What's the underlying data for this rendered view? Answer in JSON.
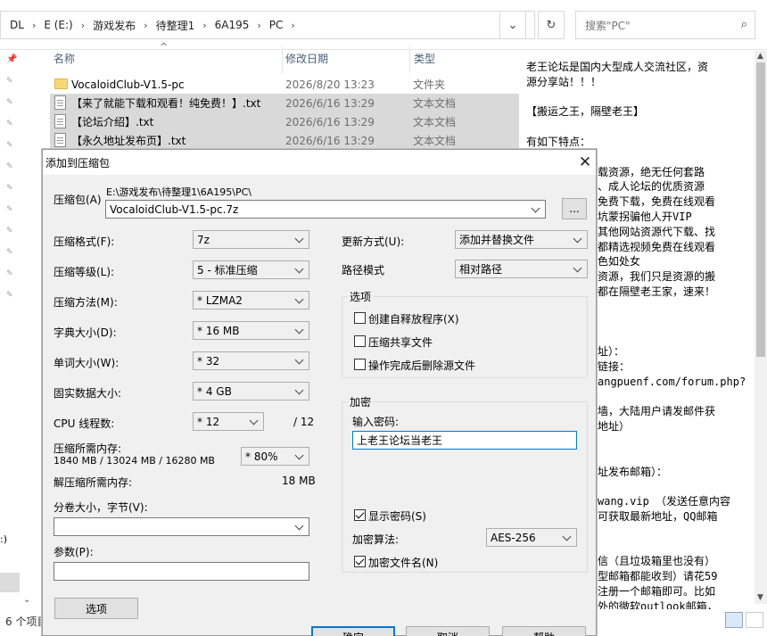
{
  "explorer": {
    "breadcrumb": [
      "DL",
      "E (E:)",
      "游戏发布",
      "待整理1",
      "6A195",
      "PC"
    ],
    "search_placeholder": "搜索\"PC\"",
    "columns": {
      "name": "名称",
      "date": "修改日期",
      "type": "类型"
    },
    "files": [
      {
        "name": "VocaloidClub-V1.5-pc",
        "date": "2026/8/20 13:23",
        "type": "文件夹",
        "icon": "folder-icon"
      },
      {
        "name": "【来了就能下载和观看！纯免费！】.txt",
        "date": "2026/6/16 13:29",
        "type": "文本文档",
        "icon": "text-file-icon"
      },
      {
        "name": "【论坛介绍】.txt",
        "date": "2026/6/16 13:29",
        "type": "文本文档",
        "icon": "text-file-icon"
      },
      {
        "name": "【永久地址发布页】.txt",
        "date": "2026/6/16 13:29",
        "type": "文本文档",
        "icon": "text-file-icon"
      }
    ],
    "status": "6 个项目",
    "left_edge_char": ":)"
  },
  "preview": {
    "lines": [
      {
        "text": "老王论坛是国内大型成人交流社区，资",
        "full": true
      },
      {
        "text": "源分享站！！！",
        "full": true
      },
      {
        "text": "",
        "full": true
      },
      {
        "text": "【搬运之王，隔壁老王】",
        "full": true
      },
      {
        "text": "",
        "full": true
      },
      {
        "text": "有如下特点：",
        "full": true
      },
      {
        "text": "",
        "full": false
      },
      {
        "text": "载资源，绝无任何套路",
        "full": false
      },
      {
        "text": "、成人论坛的优质资源",
        "full": false
      },
      {
        "text": "免费下载，免费在线观看",
        "full": false
      },
      {
        "text": "坑蒙拐骗他人开VIP",
        "full": false
      },
      {
        "text": "其他网站资源代下载、找",
        "full": false
      },
      {
        "text": "都精选视频免费在线观看",
        "full": false
      },
      {
        "text": "色如处女",
        "full": false
      },
      {
        "text": "资源，我们只是资源的搬",
        "full": false
      },
      {
        "text": "都在隔壁老王家，速来！",
        "full": false
      },
      {
        "text": "",
        "full": false
      },
      {
        "text": "",
        "full": false
      },
      {
        "text": "",
        "full": false
      },
      {
        "text": "址）：",
        "full": false
      },
      {
        "text": "链接：",
        "full": false
      },
      {
        "text": "angpuenf.com/forum.php?",
        "full": false
      },
      {
        "text": "",
        "full": false
      },
      {
        "text": "墙，大陆用户请发邮件获",
        "full": false
      },
      {
        "text": "地址）",
        "full": false
      },
      {
        "text": "",
        "full": false
      },
      {
        "text": "",
        "full": false
      },
      {
        "text": "址发布邮箱）：",
        "full": false
      },
      {
        "text": "",
        "full": false
      },
      {
        "text": "wang.vip  （发送任意内容",
        "full": false
      },
      {
        "text": "可获取最新地址，QQ邮箱",
        "full": false
      },
      {
        "text": "",
        "full": false
      },
      {
        "text": "",
        "full": false
      },
      {
        "text": "信（且垃圾箱里也没有）",
        "full": false
      },
      {
        "text": "型邮箱都能收到）请花59",
        "full": false
      },
      {
        "text": "注册一个邮箱即可。比如",
        "full": false
      },
      {
        "text": "外的微软outlook邮箱，",
        "full": false
      }
    ]
  },
  "dialog": {
    "title": "添加到压缩包",
    "archive_label": "压缩包(A)",
    "archive_path": "E:\\游戏发布\\待整理1\\6A195\\PC\\",
    "archive_name": "VocaloidClub-V1.5-pc.7z",
    "browse_label": "...",
    "fields": {
      "format": {
        "label": "压缩格式(F):",
        "value": "7z"
      },
      "level": {
        "label": "压缩等级(L):",
        "value": "5 - 标准压缩"
      },
      "method": {
        "label": "压缩方法(M):",
        "value": "* LZMA2"
      },
      "dict": {
        "label": "字典大小(D):",
        "value": "* 16 MB"
      },
      "word": {
        "label": "单词大小(W):",
        "value": "* 32"
      },
      "solid": {
        "label": "固实数据大小:",
        "value": "* 4 GB"
      },
      "threads": {
        "label": "CPU 线程数:",
        "value": "* 12",
        "max": "/ 12"
      }
    },
    "memory_label": "压缩所需内存:",
    "memory_value": "1840 MB / 13024 MB / 16280 MB",
    "memory_pct": "* 80%",
    "decomp_label": "解压缩所需内存:",
    "decomp_value": "18 MB",
    "split_label": "分卷大小，字节(V):",
    "split_value": "",
    "params_label": "参数(P):",
    "params_value": "",
    "options_button": "选项",
    "update_label": "更新方式(U):",
    "update_value": "添加并替换文件",
    "path_label": "路径模式",
    "path_value": "相对路径",
    "options_group": "选项",
    "options": [
      {
        "label": "创建自释放程序(X)",
        "checked": false
      },
      {
        "label": "压缩共享文件",
        "checked": false
      },
      {
        "label": "操作完成后删除源文件",
        "checked": false
      }
    ],
    "encrypt_group": "加密",
    "password_label": "输入密码:",
    "password_value": "上老王论坛当老王",
    "show_password": {
      "label": "显示密码(S)",
      "checked": true
    },
    "method_label": "加密算法:",
    "method_value": "AES-256",
    "encrypt_names": {
      "label": "加密文件名(N)",
      "checked": true
    },
    "ok_label": "确定",
    "cancel_label": "取消",
    "help_label": "帮助"
  }
}
